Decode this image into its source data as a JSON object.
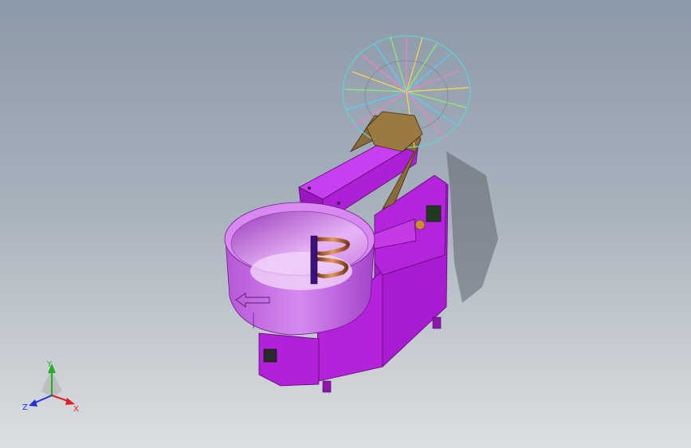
{
  "viewport": {
    "background_top": "#8c99a8",
    "background_bottom": "#dcdfe2"
  },
  "model": {
    "body_color": "#b21fd6",
    "body_dark": "#8a14a8",
    "body_light": "#d255f0",
    "bowl_color": "#c266e0",
    "spiral_color": "#c06a2a"
  },
  "triad": {
    "x_label": "X",
    "y_label": "Y",
    "z_label": "Z",
    "x_color": "#e02020",
    "y_color": "#20b020",
    "z_color": "#2030e0"
  }
}
